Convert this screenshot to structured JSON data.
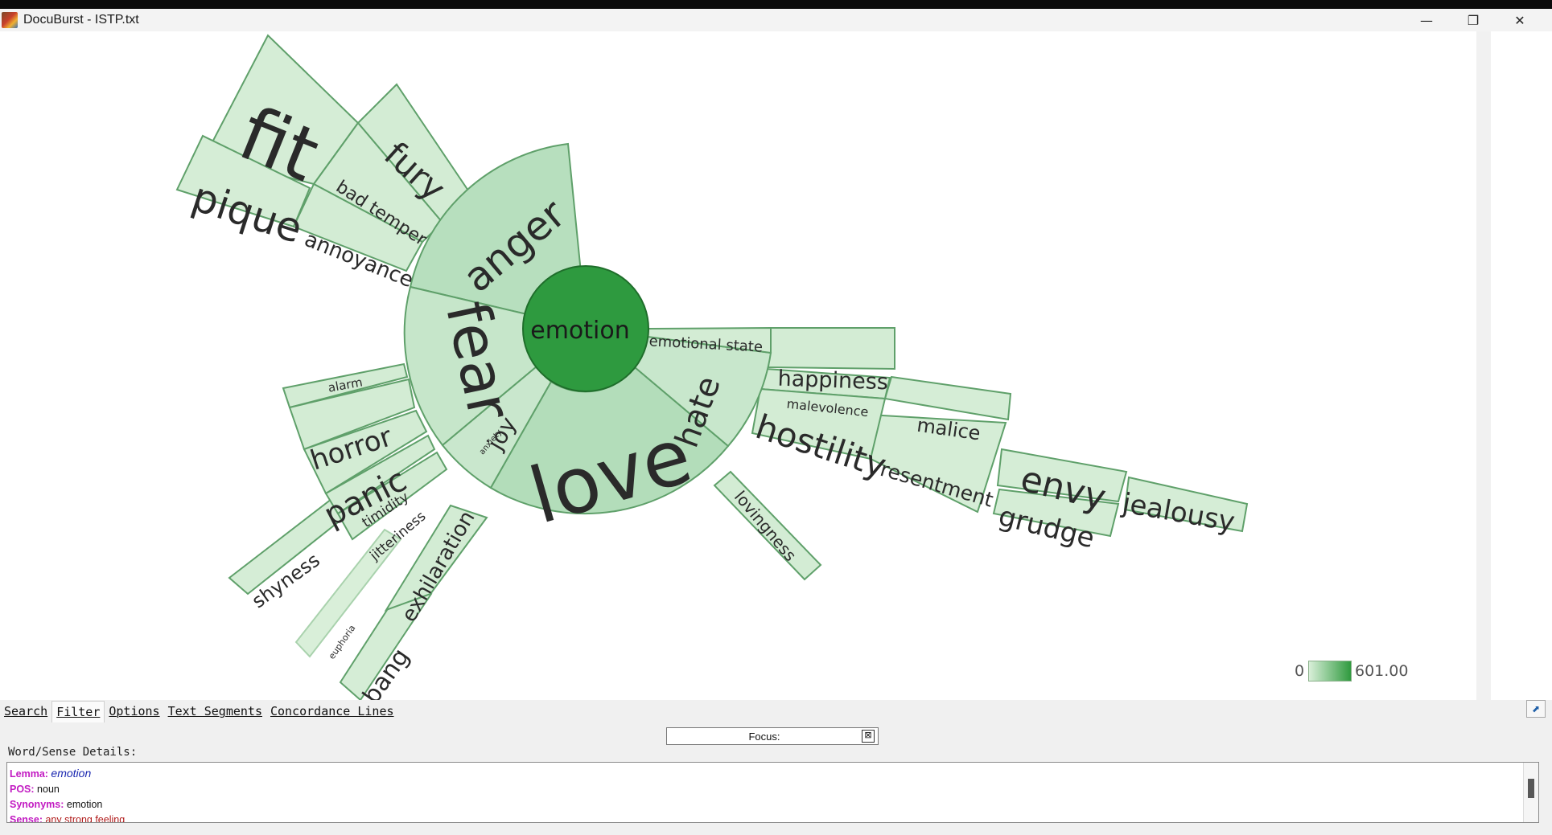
{
  "window": {
    "title": "DocuBurst - ISTP.txt",
    "minimize": "—",
    "restore": "❐",
    "close": "✕"
  },
  "sunburst": {
    "root": "emotion",
    "colors": {
      "root_fill": "#2e9a3f",
      "ring1_fill": "#b7dfbe",
      "ring2_fill": "#d3ecd4",
      "ring3_fill": "#d5edd6",
      "stroke": "#5fa06a",
      "text": "#2a2a2a"
    },
    "ring1": [
      "anger",
      "fear",
      "joy",
      "love",
      "hate",
      "emotional state"
    ],
    "ring2": [
      "fury",
      "bad temper",
      "annoyance",
      "alarm",
      "horror",
      "panic",
      "timidity",
      "jitteriness",
      "exhilaration",
      "lovingness",
      "happiness",
      "malevolence",
      "hostility"
    ],
    "ring3": [
      "fit",
      "pique",
      "shyness",
      "bang",
      "malice",
      "resentment",
      "envy",
      "grudge",
      "jealousy"
    ],
    "small_labels": [
      "euphoria",
      "anxiety"
    ]
  },
  "legend": {
    "min": "0",
    "max": "601.00"
  },
  "tabs": [
    "Search",
    "Filter",
    "Options",
    "Text Segments",
    "Concordance Lines"
  ],
  "active_tab": "Filter",
  "focus": {
    "label": "Focus:",
    "clear_icon": "⊠"
  },
  "details": {
    "title": "Word/Sense Details:",
    "lemma_key": "Lemma:",
    "lemma": "emotion",
    "pos_key": "POS:",
    "pos": "noun",
    "synonyms_key": "Synonyms:",
    "synonyms": "emotion",
    "sense_key": "Sense:",
    "sense": "any strong feeling"
  }
}
